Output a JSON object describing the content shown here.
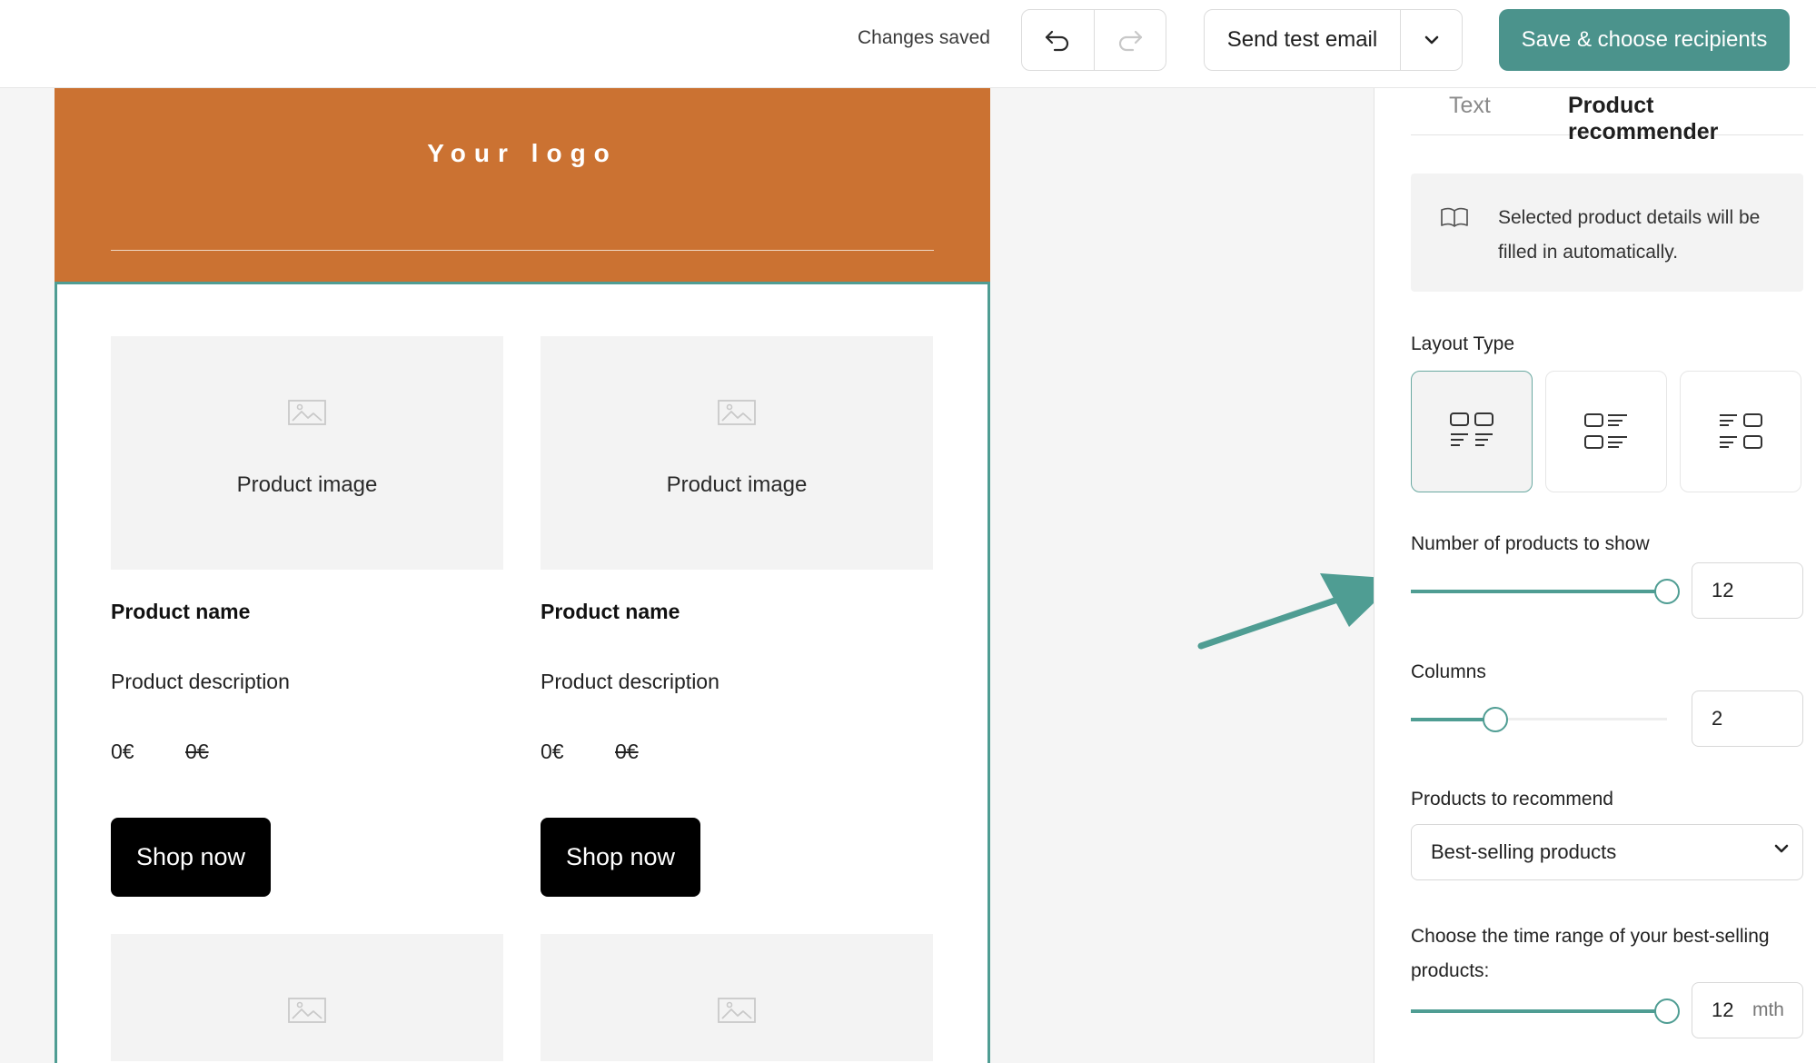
{
  "topbar": {
    "saved_status": "Changes saved",
    "send_test_label": "Send test email",
    "save_label": "Save & choose recipients",
    "accent_color": "#4b938c"
  },
  "email": {
    "header_color": "#cb7232",
    "logo_text": "Your logo",
    "products": [
      {
        "image_label": "Product image",
        "name": "Product name",
        "description": "Product description",
        "price": "0€",
        "old_price": "0€",
        "button_label": "Shop now"
      },
      {
        "image_label": "Product image",
        "name": "Product name",
        "description": "Product description",
        "price": "0€",
        "old_price": "0€",
        "button_label": "Shop now"
      }
    ]
  },
  "panel": {
    "tabs": [
      "Text",
      "Product recommender"
    ],
    "active_tab": "Product recommender",
    "info_text": "Selected product details will be filled in automatically.",
    "layout_type_label": "Layout Type",
    "layout_options": [
      "grid-layout-icon",
      "list-image-left-icon",
      "list-image-right-icon"
    ],
    "selected_layout": 0,
    "products_count": {
      "label": "Number of products to show",
      "value": "12",
      "fraction": 1.0
    },
    "columns": {
      "label": "Columns",
      "value": "2",
      "fraction": 0.33
    },
    "recommend": {
      "label": "Products to recommend",
      "selected": "Best-selling products"
    },
    "time_range": {
      "label": "Choose the time range of your best-selling products:",
      "value": "12",
      "unit": "mth",
      "fraction": 1.0
    }
  }
}
